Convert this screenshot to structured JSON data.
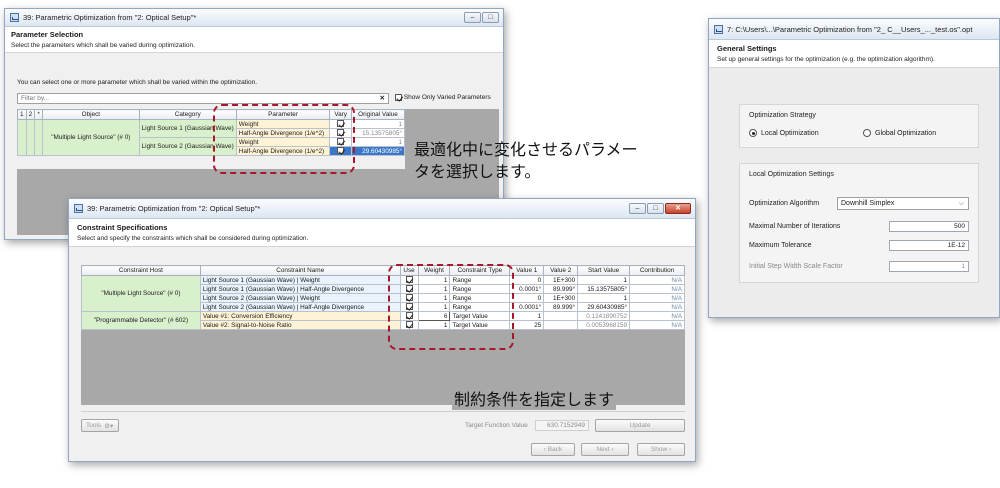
{
  "param_window": {
    "title": "39: Parametric Optimization from \"2: Optical Setup\"*",
    "section_title": "Parameter Selection",
    "section_desc": "Select the parameters which shall be varied during optimization.",
    "info_text": "You can select one or more parameter which shall be varied within the optimization.",
    "filter_placeholder": "Filter by...",
    "clear_label": "✕",
    "show_only_label": "Show Only Varied Parameters",
    "col_1": "1",
    "col_2": "2",
    "col_star": "*",
    "col_object": "Object",
    "col_category": "Category",
    "col_parameter": "Parameter",
    "col_vary": "Vary",
    "col_original": "Original Value",
    "object_name": "\"Multiple Light Source\" (# 0)",
    "category_1": "Light Source 1 (Gaussian Wave)",
    "category_2": "Light Source 2 (Gaussian Wave)",
    "rows": [
      {
        "parameter": "Weight",
        "vary": true,
        "original": "1"
      },
      {
        "parameter": "Half-Angle Divergence (1/e^2)",
        "vary": true,
        "original": "15.13575805°"
      },
      {
        "parameter": "Weight",
        "vary": true,
        "original": "1"
      },
      {
        "parameter": "Half-Angle Divergence (1/e^2)",
        "vary": true,
        "original": "29.60430985°"
      }
    ]
  },
  "annotation_1": {
    "line1": "最適化中に変化させるパラメー",
    "line2": "タを選択します。"
  },
  "annotation_2": "制約条件を指定します",
  "constraint_window": {
    "title": "39: Parametric Optimization from \"2: Optical Setup\"*",
    "section_title": "Constraint Specifications",
    "section_desc": "Select and specify the constraints which shall be considered during optimization.",
    "col_host": "Constraint Host",
    "col_name": "Constraint Name",
    "col_use": "Use",
    "col_weight": "Weight",
    "col_type": "Constraint Type",
    "col_v1": "Value 1",
    "col_v2": "Value 2",
    "col_start": "Start Value",
    "col_contrib": "Contribution",
    "host_1": "\"Multiple Light Source\" (# 0)",
    "host_2": "\"Programmable Detector\" (# 602)",
    "rows": [
      {
        "name": "Light Source 1 (Gaussian Wave) | Weight",
        "use": true,
        "weight": "1",
        "type": "Range",
        "v1": "0",
        "v2": "1E+300",
        "start": "1",
        "contrib": "N/A"
      },
      {
        "name": "Light Source 1 (Gaussian Wave) | Half-Angle Divergence",
        "use": true,
        "weight": "1",
        "type": "Range",
        "v1": "0.0001°",
        "v2": "89.999°",
        "start": "15.13575805°",
        "contrib": "N/A"
      },
      {
        "name": "Light Source 2 (Gaussian Wave) | Weight",
        "use": true,
        "weight": "1",
        "type": "Range",
        "v1": "0",
        "v2": "1E+300",
        "start": "1",
        "contrib": "N/A"
      },
      {
        "name": "Light Source 2 (Gaussian Wave) | Half-Angle Divergence",
        "use": true,
        "weight": "1",
        "type": "Range",
        "v1": "0.0001°",
        "v2": "89.999°",
        "start": "29.60430985°",
        "contrib": "N/A"
      },
      {
        "name": "Value #1: Conversion Efficiency",
        "use": true,
        "weight": "6",
        "type": "Target Value",
        "v1": "1",
        "v2": "",
        "start": "0.1241890752",
        "contrib": "N/A"
      },
      {
        "name": "Value #2: Signal-to-Noise Ratio",
        "use": true,
        "weight": "1",
        "type": "Target Value",
        "v1": "25",
        "v2": "",
        "start": "0.0053968159",
        "contrib": "N/A"
      }
    ],
    "tools_label": "Tools",
    "target_label": "Target Function Value",
    "target_value": "630.7152949",
    "update_label": "Update",
    "back_label": "‹ Back",
    "next_label": "Next ›",
    "show_label": "Show ›"
  },
  "general_window": {
    "title": "7: C:\\Users\\...\\Parametric Optimization from \"2_ C__Users_..._test.os\".opt",
    "section_title": "General Settings",
    "section_desc": "Set up general settings for the optimization (e.g. the optimization algorithm).",
    "strategy_title": "Optimization Strategy",
    "local_label": "Local Optimization",
    "global_label": "Global Optimization",
    "local_settings_title": "Local Optimization Settings",
    "algorithm_label": "Optimization Algorithm",
    "algorithm_value": "Downhill Simplex",
    "max_iter_label": "Maximal Number of Iterations",
    "max_iter_value": "500",
    "max_tol_label": "Maximum Tolerance",
    "max_tol_value": "1E-12",
    "init_step_label": "Initial Step Width Scale Factor",
    "init_step_value": "1"
  },
  "colors": {
    "dash_red": "#a8182c",
    "host_green": "#d9f0cc",
    "selected_blue": "#3a77c9"
  }
}
